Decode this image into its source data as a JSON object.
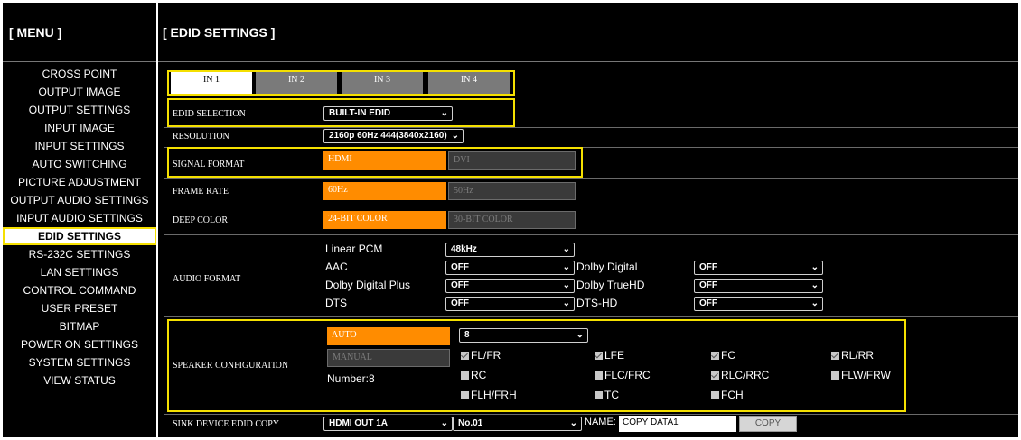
{
  "sidebar": {
    "header": "[ MENU ]",
    "items": [
      "CROSS POINT",
      "OUTPUT IMAGE",
      "OUTPUT SETTINGS",
      "INPUT IMAGE",
      "INPUT SETTINGS",
      "AUTO SWITCHING",
      "PICTURE ADJUSTMENT",
      "OUTPUT AUDIO SETTINGS",
      "INPUT AUDIO SETTINGS",
      "EDID SETTINGS",
      "RS-232C SETTINGS",
      "LAN SETTINGS",
      "CONTROL COMMAND",
      "USER PRESET",
      "BITMAP",
      "POWER ON SETTINGS",
      "SYSTEM SETTINGS",
      "VIEW STATUS"
    ]
  },
  "main": {
    "header": "[ EDID SETTINGS ]"
  },
  "tabs": [
    "IN 1",
    "IN 2",
    "IN 3",
    "IN 4"
  ],
  "edid_selection": {
    "label": "EDID SELECTION",
    "value": "BUILT-IN EDID"
  },
  "resolution": {
    "label": "RESOLUTION",
    "value": "2160p 60Hz 444(3840x2160)"
  },
  "signal_format": {
    "label": "SIGNAL FORMAT",
    "on": "HDMI",
    "off": "DVI"
  },
  "frame_rate": {
    "label": "FRAME RATE",
    "on": "60Hz",
    "off": "50Hz"
  },
  "deep_color": {
    "label": "DEEP COLOR",
    "on": "24-BIT COLOR",
    "off": "30-BIT COLOR"
  },
  "audio_format": {
    "label": "AUDIO FORMAT",
    "linear_pcm": {
      "label": "Linear PCM",
      "value": "48kHz"
    },
    "aac": {
      "label": "AAC",
      "value": "OFF"
    },
    "dolby_digital": {
      "label": "Dolby Digital",
      "value": "OFF"
    },
    "dolby_digital_plus": {
      "label": "Dolby Digital Plus",
      "value": "OFF"
    },
    "dolby_truehd": {
      "label": "Dolby TrueHD",
      "value": "OFF"
    },
    "dts": {
      "label": "DTS",
      "value": "OFF"
    },
    "dts_hd": {
      "label": "DTS-HD",
      "value": "OFF"
    }
  },
  "speaker": {
    "label": "SPEAKER CONFIGURATION",
    "auto": "AUTO",
    "manual": "MANUAL",
    "count_value": "8",
    "number_text": "Number:8",
    "checks": {
      "fl_fr": "FL/FR",
      "lfe": "LFE",
      "fc": "FC",
      "rl_rr": "RL/RR",
      "rc": "RC",
      "flc_frc": "FLC/FRC",
      "rlc_rrc": "RLC/RRC",
      "flw_frw": "FLW/FRW",
      "flh_frh": "FLH/FRH",
      "tc": "TC",
      "fch": "FCH"
    }
  },
  "sink_copy": {
    "label": "SINK DEVICE EDID COPY",
    "output": "HDMI OUT 1A",
    "slot": "No.01",
    "name_label": "NAME:",
    "name_value": "COPY DATA1",
    "copy_button": "COPY"
  },
  "colors": {
    "accent": "#ff8c00",
    "highlight": "#f5e000",
    "background": "#000000"
  }
}
